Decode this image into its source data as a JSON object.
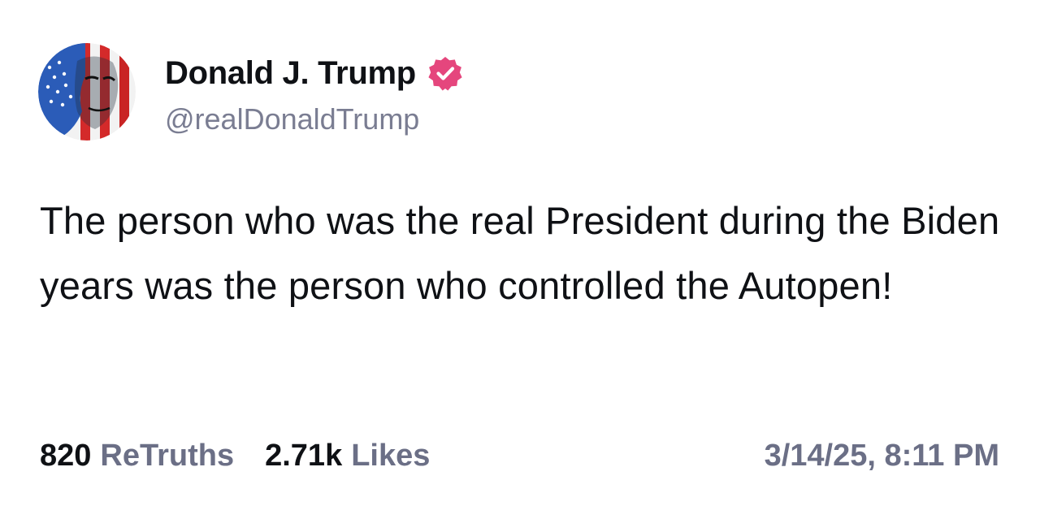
{
  "author": {
    "display_name": "Donald J. Trump",
    "handle": "@realDonaldTrump",
    "verified": true,
    "verified_color": "#e5467d"
  },
  "post": {
    "text": "The person who was the real President during the Biden years was the person who controlled the Autopen!"
  },
  "stats": {
    "retruths_count": "820",
    "retruths_label": "ReTruths",
    "likes_count": "2.71k",
    "likes_label": "Likes"
  },
  "timestamp": "3/14/25, 8:11 PM",
  "icons": {
    "avatar": "profile-photo",
    "verified": "verified-badge-icon"
  }
}
